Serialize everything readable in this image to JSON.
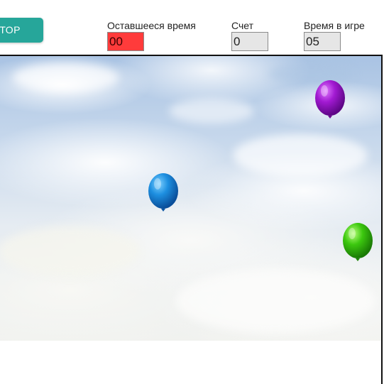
{
  "controls": {
    "stop_label": "ТОР"
  },
  "stats": {
    "remaining": {
      "label": "Оставшееся время",
      "value": "00",
      "color": "#ff3b3b"
    },
    "score": {
      "label": "Счет",
      "value": "0"
    },
    "ingame": {
      "label": "Время в игре",
      "value": "05"
    }
  },
  "game": {
    "balloons": [
      {
        "color": "purple",
        "hex": "#9b10c9"
      },
      {
        "color": "blue",
        "hex": "#1e88e5"
      },
      {
        "color": "green",
        "hex": "#33c20f"
      }
    ]
  },
  "colors": {
    "accent": "#26a69a",
    "frame": "#111111"
  }
}
